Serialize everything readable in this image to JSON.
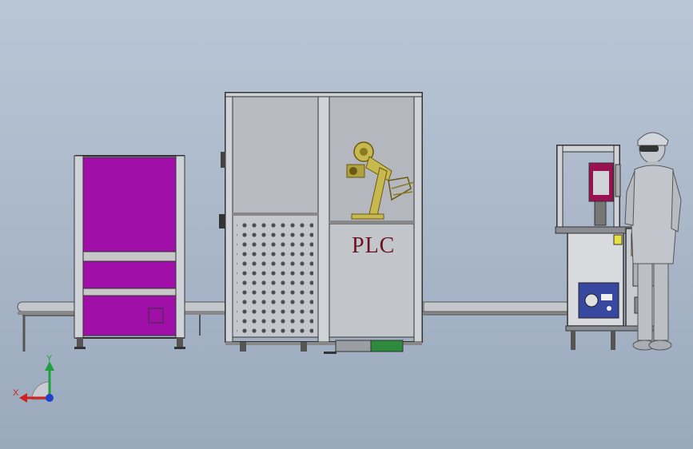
{
  "machine": {
    "control_cabinet_label": "PLC"
  },
  "triad": {
    "x_label": "X",
    "y_label": "Y",
    "x_color": "#d22020",
    "y_color": "#20a040",
    "z_color": "#2040d0"
  },
  "colors": {
    "background": "#a6b4c6",
    "magenta_panel": "#a010a8",
    "yellow_panel": "#e8e040",
    "robot_arm": "#c8b850",
    "frame": "#4a4e55"
  }
}
